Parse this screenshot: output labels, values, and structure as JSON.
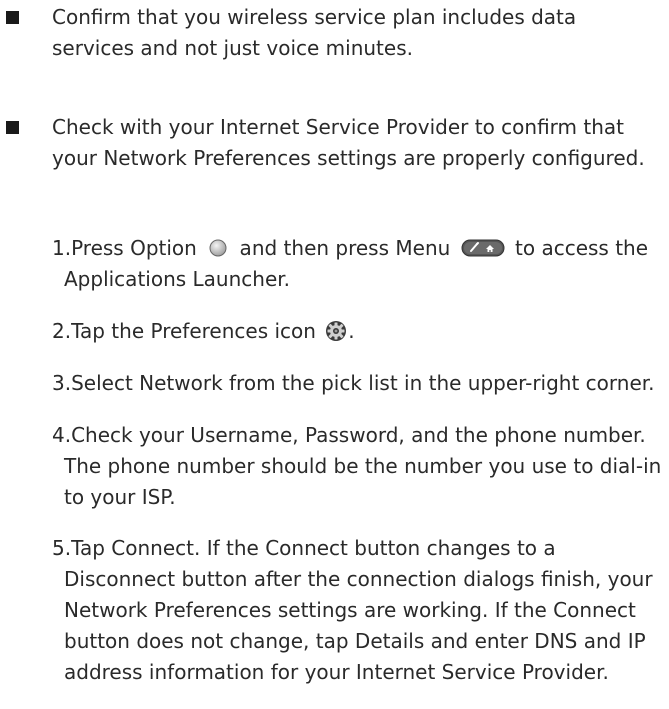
{
  "bullets": [
    {
      "text": "Confirm that you wireless service plan includes data services and not just voice minutes."
    },
    {
      "text": "Check with your Internet Service Provider to confirm that your Network Preferences settings are properly configured."
    }
  ],
  "steps": {
    "s1": {
      "num": "1.",
      "before_option": "Press Option",
      "between": "and then press Menu",
      "after_menu": "to access the Applications Launcher."
    },
    "s2": {
      "num": "2.",
      "before_icon": "Tap the Preferences icon",
      "after_icon": "."
    },
    "s3": {
      "num": "3.",
      "text": "Select Network from the pick list in the upper-right corner."
    },
    "s4": {
      "num": "4.",
      "text": "Check your Username, Password, and the phone number. The phone number should be the number you use to dial-in to your ISP."
    },
    "s5": {
      "num": "5.",
      "text": "Tap Connect. If the Connect button changes to a Disconnect button after the connection dialogs finish, your Network Preferences settings are working. If the Connect button does not change, tap Details and enter DNS and IP address information for your Internet Service Provider."
    }
  },
  "icons": {
    "option": "option-key-icon",
    "menu": "menu-home-key-icon",
    "preferences": "preferences-gear-icon"
  }
}
